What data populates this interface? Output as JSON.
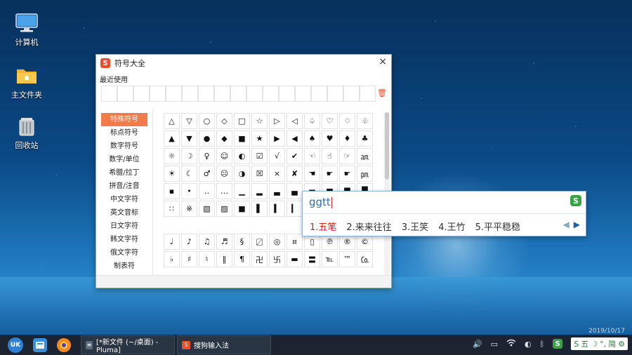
{
  "desktop": {
    "icons": [
      {
        "label": "计算机",
        "icon": "computer-icon"
      },
      {
        "label": "主文件夹",
        "icon": "folder-icon"
      },
      {
        "label": "回收站",
        "icon": "trash-icon"
      }
    ]
  },
  "symbol_window": {
    "title": "符号大全",
    "close": "×",
    "recent_label": "最近使用",
    "recent_clear": "🗑",
    "categories": [
      "特殊符号",
      "标点符号",
      "数字符号",
      "数字/单位",
      "希腊/拉丁",
      "拼音/注音",
      "中文字符",
      "英文音标",
      "日文字符",
      "韩文字符",
      "俄文字符",
      "制表符"
    ],
    "active_category": 0,
    "grid_rows": [
      [
        "△",
        "▽",
        "○",
        "◇",
        "□",
        "☆",
        "▷",
        "◁",
        "♤",
        "♡",
        "♢",
        "♧"
      ],
      [
        "▲",
        "▼",
        "●",
        "◆",
        "■",
        "★",
        "▶",
        "◀",
        "♠",
        "♥",
        "♦",
        "♣"
      ],
      [
        "☼",
        "☽",
        "♀",
        "☺",
        "◐",
        "☑",
        "√",
        "✔",
        "☜",
        "☝",
        "☞",
        "㏂"
      ],
      [
        "☀",
        "☾",
        "♂",
        "☹",
        "◑",
        "☒",
        "×",
        "✘",
        "☚",
        "☛",
        "☛",
        "㏘"
      ],
      [
        "▪",
        "•",
        "‥",
        "…",
        "▁",
        "▂",
        "▃",
        "▄",
        "▅",
        "▆",
        "▇",
        "█"
      ],
      [
        "∷",
        "※",
        "▧",
        "▨",
        "■",
        "▌",
        "▍",
        "▎",
        "",
        "",
        "",
        ""
      ],
      [
        "♩",
        "♪",
        "♫",
        "♬",
        "§",
        "〼",
        "◎",
        "¤",
        "▯",
        "℗",
        "®",
        "©"
      ],
      [
        "♭",
        "♯",
        "♮",
        "‖",
        "¶",
        "卍",
        "卐",
        "▬",
        "〓",
        "℡",
        "™",
        "㏇"
      ]
    ]
  },
  "ime": {
    "input": "ggtt",
    "logo": "S",
    "candidates": [
      "1.五笔",
      "2.来来往往",
      "3.王笑",
      "4.王竹",
      "5.平平稳稳"
    ],
    "prev": "◀",
    "next": "▶"
  },
  "taskbar": {
    "start_label": "UK",
    "tasks": [
      {
        "label": "[*新文件 (~/桌面) - Pluma]"
      },
      {
        "label": "搜狗输入法"
      }
    ],
    "ime_status": [
      "S",
      "五",
      "☽",
      "°,",
      "简",
      "⚙"
    ],
    "clock": "2019/10/17"
  },
  "colors": {
    "accent_orange": "#f47a4a",
    "sogou_green": "#3aa34a",
    "candidate_red": "#d0201a",
    "input_blue": "#2a6fb5"
  }
}
